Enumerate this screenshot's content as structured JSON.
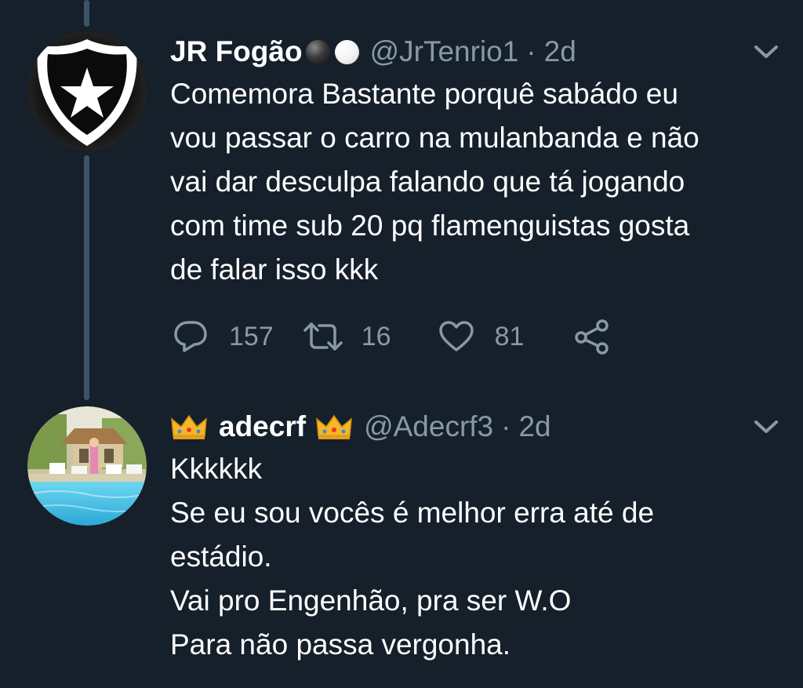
{
  "tweets": [
    {
      "name": "JR Fogão",
      "handle": "@JrTenrio1",
      "separator": "·",
      "time": "2d",
      "text": "Comemora Bastante porquê sabádo eu\nvou passar o carro na mulanbanda e não\nvai dar desculpa falando que tá jogando\ncom time sub 20 pq flamenguistas gosta\nde falar isso kkk",
      "actions": {
        "replies": "157",
        "retweets": "16",
        "likes": "81"
      }
    },
    {
      "name": "adecrf",
      "handle": "@Adecrf3",
      "separator": "·",
      "time": "2d",
      "text": "Kkkkkk\nSe eu sou vocês é melhor erra até de\nestádio.\nVai pro Engenhão, pra ser W.O\nPara não passa vergonha."
    }
  ],
  "icons": {
    "reply": "reply-icon",
    "retweet": "retweet-icon",
    "like": "heart-icon",
    "share": "share-icon",
    "menu": "chevron-down-icon"
  },
  "colors": {
    "background": "#15202b",
    "text": "#ffffff",
    "secondary": "#8899a6",
    "thread_line": "#3d5466"
  }
}
